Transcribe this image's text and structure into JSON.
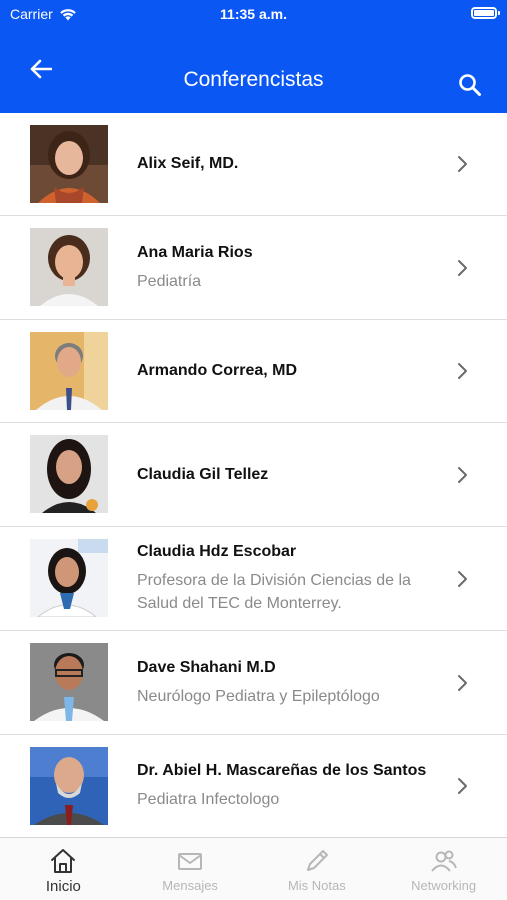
{
  "status_bar": {
    "carrier": "Carrier",
    "time": "11:35 a.m."
  },
  "header": {
    "title": "Conferencistas",
    "back_icon": "arrow-left-icon",
    "search_icon": "search-icon"
  },
  "colors": {
    "primary": "#0a57f4",
    "divider": "#dedede",
    "subtitle": "#8a8a8a",
    "tab_inactive": "#b7b7b7",
    "tab_active": "#333333"
  },
  "speakers": [
    {
      "name": "Alix Seif, MD.",
      "subtitle": ""
    },
    {
      "name": "Ana Maria Rios",
      "subtitle": "Pediatría"
    },
    {
      "name": "Armando Correa, MD",
      "subtitle": ""
    },
    {
      "name": "Claudia Gil Tellez",
      "subtitle": ""
    },
    {
      "name": "Claudia Hdz Escobar",
      "subtitle": "Profesora de la División Ciencias de la Salud del TEC de Monterrey."
    },
    {
      "name": "Dave Shahani M.D",
      "subtitle": "Neurólogo Pediatra y Epileptólogo"
    },
    {
      "name": "Dr. Abiel H. Mascareñas de los Santos",
      "subtitle": "Pediatra Infectologo"
    }
  ],
  "tabs": [
    {
      "label": "Inicio",
      "icon": "home-icon",
      "active": true
    },
    {
      "label": "Mensajes",
      "icon": "mail-icon",
      "active": false
    },
    {
      "label": "Mis Notas",
      "icon": "pencil-icon",
      "active": false
    },
    {
      "label": "Networking",
      "icon": "people-icon",
      "active": false
    }
  ]
}
